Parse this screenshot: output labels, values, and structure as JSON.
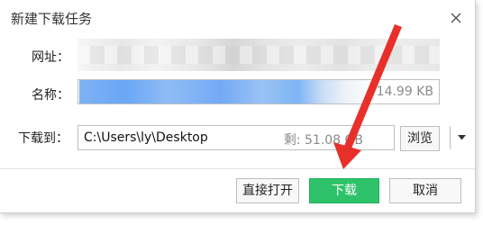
{
  "dialog": {
    "title": "新建下载任务",
    "close_icon": "close-icon"
  },
  "form": {
    "url_label": "网址：",
    "name_label": "名称：",
    "size": "14.99 KB",
    "save_to_label": "下载到：",
    "save_path": "C:\\Users\\ly\\Desktop",
    "free_space": "剩: 51.08 GB",
    "dropdown_icon": "chevron-down-icon",
    "browse_label": "浏览"
  },
  "buttons": {
    "open_direct_label": "直接打开",
    "download_label": "下载",
    "cancel_label": "取消"
  },
  "colors": {
    "download_button": "#2ec36a",
    "annotation_arrow": "#e8302a",
    "name_highlight": "#7fb2f4"
  }
}
